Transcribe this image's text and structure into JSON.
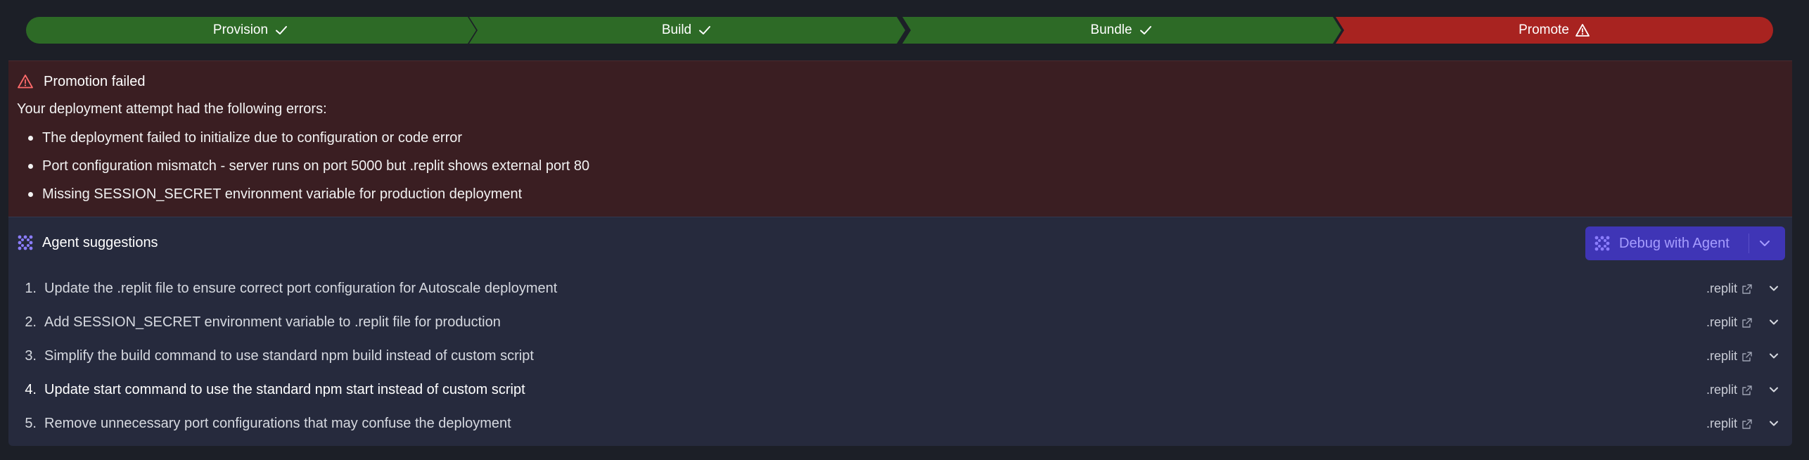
{
  "steps": [
    {
      "label": "Provision",
      "status": "done"
    },
    {
      "label": "Build",
      "status": "done"
    },
    {
      "label": "Bundle",
      "status": "done"
    },
    {
      "label": "Promote",
      "status": "failed"
    }
  ],
  "error": {
    "title": "Promotion failed",
    "intro": "Your deployment attempt had the following errors:",
    "items": [
      "The deployment failed to initialize due to configuration or code error",
      "Port configuration mismatch - server runs on port 5000 but .replit shows external port 80",
      "Missing SESSION_SECRET environment variable for production deployment"
    ]
  },
  "suggestions": {
    "title": "Agent suggestions",
    "debug_button": "Debug with Agent",
    "items": [
      {
        "num": "1.",
        "text": "Update the .replit file to ensure correct port configuration for Autoscale deployment",
        "file": ".replit"
      },
      {
        "num": "2.",
        "text": "Add SESSION_SECRET environment variable to .replit file for production",
        "file": ".replit"
      },
      {
        "num": "3.",
        "text": "Simplify the build command to use standard npm build instead of custom script",
        "file": ".replit"
      },
      {
        "num": "4.",
        "text": "Update start command to use the standard npm start instead of custom script",
        "file": ".replit"
      },
      {
        "num": "5.",
        "text": "Remove unnecessary port configurations that may confuse the deployment",
        "file": ".replit"
      }
    ]
  },
  "colors": {
    "success": "#2d6a26",
    "failure": "#a82320",
    "accent": "#3f35b6",
    "agent_icon": "#8b7dff",
    "error_icon": "#ff6b6b"
  }
}
